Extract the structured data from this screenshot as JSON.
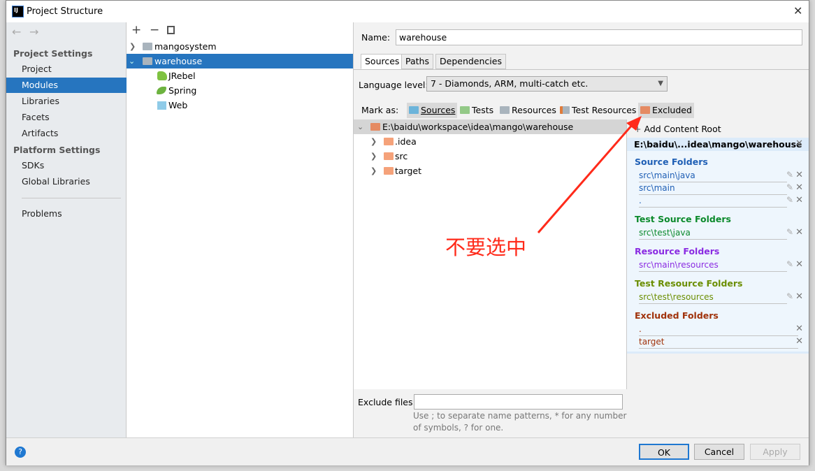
{
  "window": {
    "title": "Project Structure",
    "close": "✕"
  },
  "sidebar": {
    "project_settings": "Project Settings",
    "items1": [
      "Project",
      "Modules",
      "Libraries",
      "Facets",
      "Artifacts"
    ],
    "platform_settings": "Platform Settings",
    "items2": [
      "SDKs",
      "Global Libraries"
    ],
    "problems": "Problems"
  },
  "tree": {
    "modules": [
      {
        "label": "mangosystem",
        "expanded": false
      },
      {
        "label": "warehouse",
        "expanded": true,
        "selected": true
      }
    ],
    "facets": [
      "JRebel",
      "Spring",
      "Web"
    ]
  },
  "main": {
    "name_label": "Name:",
    "name_value": "warehouse",
    "tabs": [
      "Sources",
      "Paths",
      "Dependencies"
    ],
    "language_label": "Language level:",
    "language_value": "7 - Diamonds, ARM, multi-catch etc.",
    "mark_as_label": "Mark as:",
    "mark_buttons": [
      "Sources",
      "Tests",
      "Resources",
      "Test Resources",
      "Excluded"
    ],
    "root_path": "E:\\baidu\\workspace\\idea\\mango\\warehouse",
    "children": [
      ".idea",
      "src",
      "target"
    ],
    "exclude_label": "Exclude files:",
    "exclude_value": "",
    "exclude_hint_1": "Use ; to separate name patterns, * for any number",
    "exclude_hint_2": "of symbols, ? for one."
  },
  "roots": {
    "add": "Add Content Root",
    "root": "E:\\baidu\\...idea\\mango\\warehouse",
    "groups": [
      {
        "title": "Source Folders",
        "color": "#1f5fb5",
        "items": [
          "src\\main\\java",
          "src\\main",
          "."
        ]
      },
      {
        "title": "Test Source Folders",
        "color": "#0c8a2c",
        "items": [
          "src\\test\\java"
        ]
      },
      {
        "title": "Resource Folders",
        "color": "#8a2be2",
        "items": [
          "src\\main\\resources"
        ]
      },
      {
        "title": "Test Resource Folders",
        "color": "#6b8e00",
        "items": [
          "src\\test\\resources"
        ]
      },
      {
        "title": "Excluded Folders",
        "color": "#a0320a",
        "items": [
          ".",
          "target"
        ]
      }
    ]
  },
  "footer": {
    "ok": "OK",
    "cancel": "Cancel",
    "apply": "Apply",
    "help": "?"
  },
  "annotation": {
    "text": "不要选中",
    "color": "#ff2a1a"
  }
}
